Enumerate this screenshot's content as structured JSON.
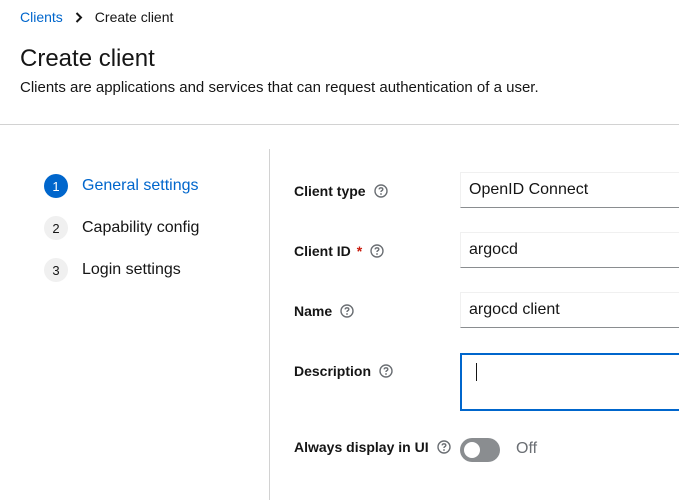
{
  "breadcrumb": {
    "parent": "Clients",
    "current": "Create client"
  },
  "header": {
    "title": "Create client",
    "description": "Clients are applications and services that can request authentication of a user."
  },
  "wizard": {
    "steps": [
      {
        "number": "1",
        "label": "General settings",
        "active": true
      },
      {
        "number": "2",
        "label": "Capability config",
        "active": false
      },
      {
        "number": "3",
        "label": "Login settings",
        "active": false
      }
    ]
  },
  "form": {
    "client_type": {
      "label": "Client type",
      "value": "OpenID Connect"
    },
    "client_id": {
      "label": "Client ID",
      "required_mark": "*",
      "value": "argocd"
    },
    "name": {
      "label": "Name",
      "value": "argocd client"
    },
    "description": {
      "label": "Description",
      "value": ""
    },
    "always_display": {
      "label": "Always display in UI",
      "state": "Off"
    }
  },
  "colors": {
    "accent": "#0066cc",
    "required": "#c9190b",
    "toggle_off": "#8a8d90"
  },
  "icons": {
    "breadcrumb_separator": "chevron-right-icon",
    "help": "help-icon"
  }
}
